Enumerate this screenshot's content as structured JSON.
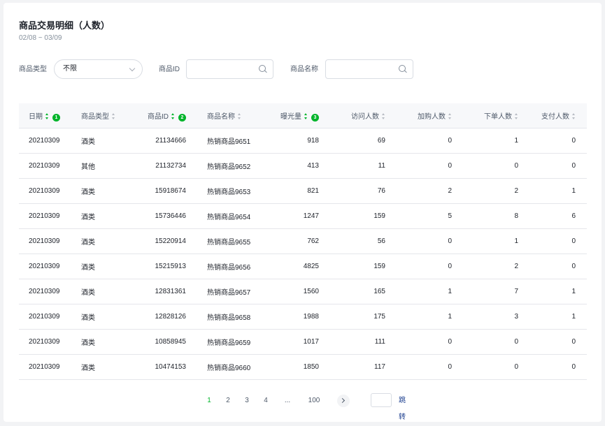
{
  "header": {
    "title": "商品交易明细（人数）",
    "date_range": "02/08 ~ 03/09"
  },
  "filters": {
    "category_label": "商品类型",
    "category_value": "不限",
    "id_label": "商品ID",
    "id_value": "",
    "name_label": "商品名称",
    "name_value": ""
  },
  "table": {
    "columns": [
      {
        "label": "日期",
        "badge": "1",
        "active": true
      },
      {
        "label": "商品类型",
        "badge": "",
        "active": false
      },
      {
        "label": "商品ID",
        "badge": "2",
        "active": true
      },
      {
        "label": "商品名称",
        "badge": "",
        "active": false
      },
      {
        "label": "曝光量",
        "badge": "3",
        "active": true
      },
      {
        "label": "访问人数",
        "badge": "",
        "active": false
      },
      {
        "label": "加购人数",
        "badge": "",
        "active": false
      },
      {
        "label": "下单人数",
        "badge": "",
        "active": false
      },
      {
        "label": "支付人数",
        "badge": "",
        "active": false
      }
    ],
    "rows": [
      [
        "20210309",
        "酒类",
        "21134666",
        "热销商品9651",
        "918",
        "69",
        "0",
        "1",
        "0"
      ],
      [
        "20210309",
        "其他",
        "21132734",
        "热销商品9652",
        "413",
        "11",
        "0",
        "0",
        "0"
      ],
      [
        "20210309",
        "酒类",
        "15918674",
        "热销商品9653",
        "821",
        "76",
        "2",
        "2",
        "1"
      ],
      [
        "20210309",
        "酒类",
        "15736446",
        "热销商品9654",
        "1247",
        "159",
        "5",
        "8",
        "6"
      ],
      [
        "20210309",
        "酒类",
        "15220914",
        "热销商品9655",
        "762",
        "56",
        "0",
        "1",
        "0"
      ],
      [
        "20210309",
        "酒类",
        "15215913",
        "热销商品9656",
        "4825",
        "159",
        "0",
        "2",
        "0"
      ],
      [
        "20210309",
        "酒类",
        "12831361",
        "热销商品9657",
        "1560",
        "165",
        "1",
        "7",
        "1"
      ],
      [
        "20210309",
        "酒类",
        "12828126",
        "热销商品9658",
        "1988",
        "175",
        "1",
        "3",
        "1"
      ],
      [
        "20210309",
        "酒类",
        "10858945",
        "热销商品9659",
        "1017",
        "111",
        "0",
        "0",
        "0"
      ],
      [
        "20210309",
        "酒类",
        "10474153",
        "热销商品9660",
        "1850",
        "117",
        "0",
        "0",
        "0"
      ]
    ]
  },
  "pagination": {
    "pages": [
      "1",
      "2",
      "3",
      "4",
      "...",
      "100"
    ],
    "current": "1",
    "jump_label": "跳转",
    "jump_value": ""
  },
  "colors": {
    "accent": "#00b42a",
    "link": "#1d3f8f"
  }
}
